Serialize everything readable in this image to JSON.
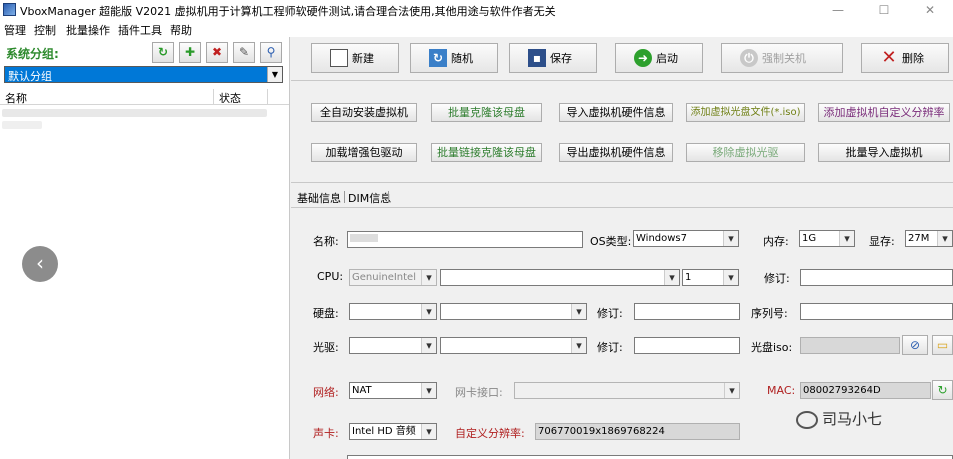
{
  "window": {
    "title": "VboxManager 超能版 V2021 虚拟机用于计算机工程师软硬件测试,请合理合法使用,其他用途与软件作者无关",
    "minimize": "—",
    "maximize": "☐",
    "close": "✕"
  },
  "menu": [
    "管理",
    "控制",
    "批量操作",
    "插件工具",
    "帮助"
  ],
  "left": {
    "group_label": "系统分组:",
    "group_value": "默认分组",
    "columns": [
      "名称",
      "状态"
    ]
  },
  "toolbar": [
    {
      "label": "新建",
      "icon": "new-file-icon"
    },
    {
      "label": "随机",
      "icon": "refresh-icon"
    },
    {
      "label": "保存",
      "icon": "save-icon"
    },
    {
      "label": "启动",
      "icon": "start-icon"
    },
    {
      "label": "强制关机",
      "icon": "power-icon"
    },
    {
      "label": "删除",
      "icon": "delete-x-icon"
    }
  ],
  "actions_row1": [
    "全自动安装虚拟机",
    "批量克隆该母盘",
    "导入虚拟机硬件信息",
    "添加虚拟光盘文件(*.iso)",
    "添加虚拟机自定义分辨率"
  ],
  "actions_row2": [
    "加载增强包驱动",
    "批量链接克隆该母盘",
    "导出虚拟机硬件信息",
    "移除虚拟光驱",
    "批量导入虚拟机"
  ],
  "tabs": [
    "基础信息",
    "DIM信息"
  ],
  "form": {
    "name_label": "名称:",
    "os_label": "OS类型:",
    "os_value": "Windows7",
    "memory_label": "内存:",
    "memory_value": "1G",
    "vram_label": "显存:",
    "vram_value": "27M",
    "cpu_label": "CPU:",
    "cpu_vendor": "GenuineIntel",
    "cpu_count": "1",
    "revise_label": "修订:",
    "disk_label": "硬盘:",
    "serial_label": "序列号:",
    "cdrom_label": "光驱:",
    "iso_label": "光盘iso:",
    "network_label": "网络:",
    "network_value": "NAT",
    "nic_label": "网卡接口:",
    "mac_label": "MAC:",
    "mac_value": "08002793264D",
    "sound_label": "声卡:",
    "sound_value": "Intel HD 音频",
    "resolution_label": "自定义分辨率:",
    "resolution_value": "706770019x1869768224"
  },
  "watermark": "司马小七"
}
